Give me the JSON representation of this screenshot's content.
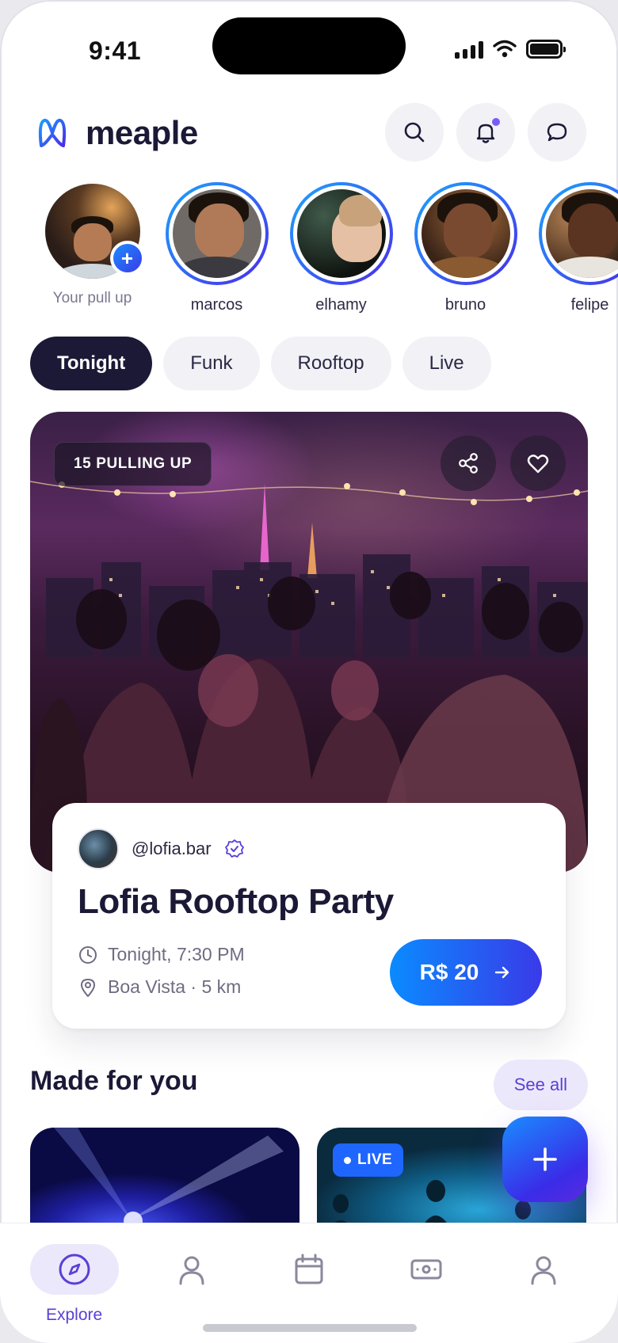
{
  "status_bar": {
    "time": "9:41"
  },
  "app": {
    "name": "meaple",
    "logo_icon": "meaple-logo-icon",
    "accent": "#5a3fd6",
    "dark": "#1b1936"
  },
  "header_actions": [
    {
      "name": "search-button",
      "icon": "search-icon"
    },
    {
      "name": "notifications-button",
      "icon": "bell-icon",
      "has_dot": true
    },
    {
      "name": "messages-button",
      "icon": "chat-bubble-icon"
    }
  ],
  "stories": {
    "own_label": "Your pull up",
    "people": [
      {
        "label": "marcos"
      },
      {
        "label": "elhamy"
      },
      {
        "label": "bruno"
      },
      {
        "label": "felipe"
      }
    ]
  },
  "chips": [
    {
      "label": "Tonight",
      "active": true
    },
    {
      "label": "Funk",
      "active": false
    },
    {
      "label": "Rooftop",
      "active": false
    },
    {
      "label": "Live",
      "active": false
    }
  ],
  "hero": {
    "badge": "15 PULLING UP",
    "share_icon": "share-icon",
    "favorite_icon": "heart-icon"
  },
  "event": {
    "host_handle": "@lofia.bar",
    "verified_icon": "verified-badge-icon",
    "title": "Lofia Rooftop Party",
    "time": "Tonight, 7:30 PM",
    "location": "Boa Vista · 5 km",
    "price": "R$ 20"
  },
  "made_for_you": {
    "title": "Made for you",
    "see_all": "See all",
    "live_badge": "LIVE"
  },
  "bottom_nav": {
    "active_label": "Explore",
    "items": [
      "compass-icon",
      "person-icon",
      "calendar-icon",
      "ticket-icon",
      "profile-icon"
    ]
  }
}
